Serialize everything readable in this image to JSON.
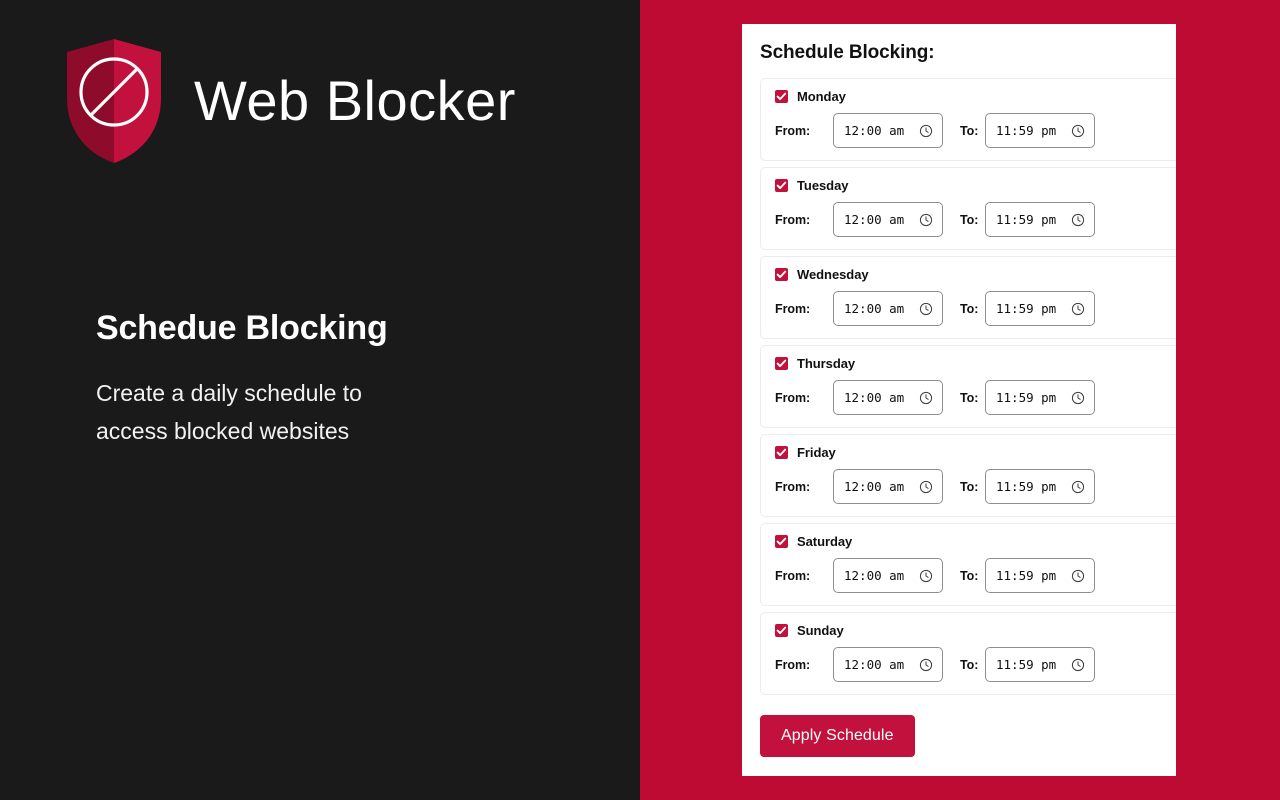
{
  "brand": {
    "title": "Web Blocker",
    "logo_icon": "shield-prohibited-icon"
  },
  "left": {
    "heading": "Schedue Blocking",
    "subtext": "Create a daily schedule to access blocked websites"
  },
  "panel": {
    "title": "Schedule Blocking:",
    "from_label": "From:",
    "to_label": "To:",
    "clock_icon": "clock-icon",
    "check_icon": "check-icon",
    "apply_label": "Apply Schedule"
  },
  "days": [
    {
      "name": "Monday",
      "checked": true,
      "from": "12:00 am",
      "to": "11:59 pm"
    },
    {
      "name": "Tuesday",
      "checked": true,
      "from": "12:00 am",
      "to": "11:59 pm"
    },
    {
      "name": "Wednesday",
      "checked": true,
      "from": "12:00 am",
      "to": "11:59 pm"
    },
    {
      "name": "Thursday",
      "checked": true,
      "from": "12:00 am",
      "to": "11:59 pm"
    },
    {
      "name": "Friday",
      "checked": true,
      "from": "12:00 am",
      "to": "11:59 pm"
    },
    {
      "name": "Saturday",
      "checked": true,
      "from": "12:00 am",
      "to": "11:59 pm"
    },
    {
      "name": "Sunday",
      "checked": true,
      "from": "12:00 am",
      "to": "11:59 pm"
    }
  ],
  "colors": {
    "crimson_bg": "#bd0b33",
    "crimson_accent": "#c2113d",
    "shield_dark": "#8e0b2c",
    "dark_panel": "#1a1a1a"
  }
}
